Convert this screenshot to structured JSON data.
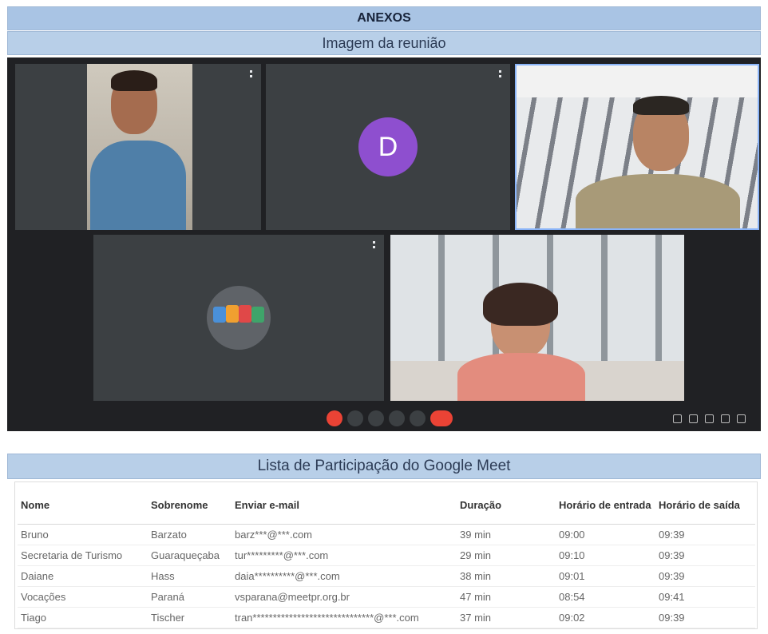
{
  "header": {
    "title": "ANEXOS"
  },
  "meeting_section": {
    "title": "Imagem da reunião",
    "tiles": [
      {
        "avatar_letter": ""
      },
      {
        "avatar_letter": "D"
      },
      {
        "avatar_letter": ""
      },
      {
        "avatar_letter": ""
      },
      {
        "avatar_letter": ""
      }
    ]
  },
  "participants_section": {
    "title": "Lista de Participação do Google Meet",
    "columns": [
      "Nome",
      "Sobrenome",
      "Enviar e-mail",
      "Duração",
      "Horário de entrada",
      "Horário de saída"
    ],
    "rows": [
      [
        "Bruno",
        "Barzato",
        "barz***@***.com",
        "39 min",
        "09:00",
        "09:39"
      ],
      [
        "Secretaria de Turismo",
        "Guaraqueçaba",
        "tur*********@***.com",
        "29 min",
        "09:10",
        "09:39"
      ],
      [
        "Daiane",
        "Hass",
        "daia**********@***.com",
        "38 min",
        "09:01",
        "09:39"
      ],
      [
        "Vocações",
        "Paraná",
        "vsparana@meetpr.org.br",
        "47 min",
        "08:54",
        "09:41"
      ],
      [
        "Tiago",
        "Tischer",
        "tran******************************@***.com",
        "37 min",
        "09:02",
        "09:39"
      ]
    ]
  }
}
